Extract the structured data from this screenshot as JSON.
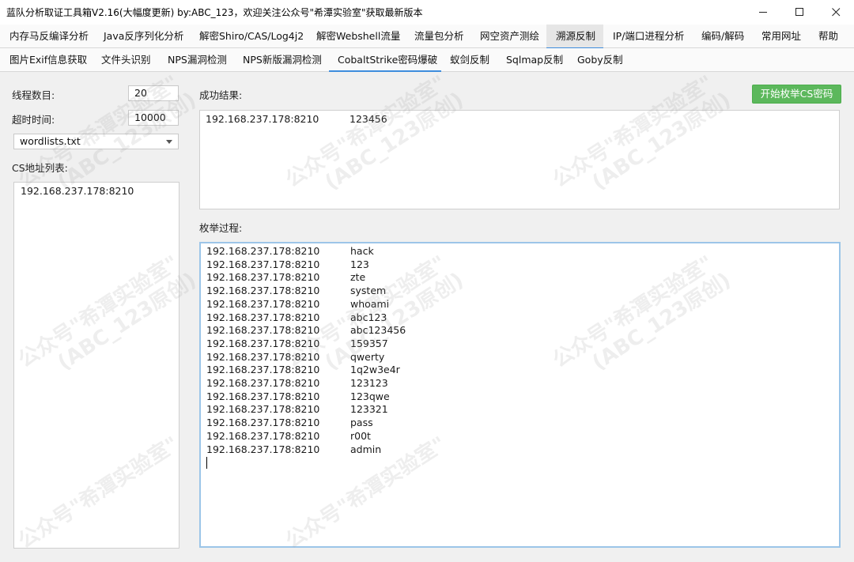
{
  "window": {
    "title": "蓝队分析取证工具箱V2.16(大幅度更新) by:ABC_123，欢迎关注公众号\"希潭实验室\"获取最新版本"
  },
  "menu": {
    "items": [
      "内存马反编译分析",
      "Java反序列化分析",
      "解密Shiro/CAS/Log4j2",
      "解密Webshell流量",
      "流量包分析",
      "网空资产测绘",
      "溯源反制",
      "IP/端口进程分析",
      "编码/解码",
      "常用网址",
      "帮助"
    ],
    "active": "溯源反制"
  },
  "subtabs": {
    "items": [
      "图片Exif信息获取",
      "文件头识别",
      "NPS漏洞检测",
      "NPS新版漏洞检测",
      "CobaltStrike密码爆破",
      "蚁剑反制",
      "Sqlmap反制",
      "Goby反制"
    ],
    "active": "CobaltStrike密码爆破"
  },
  "form": {
    "threads_label": "线程数目:",
    "threads_value": "20",
    "timeout_label": "超时时间:",
    "timeout_value": "10000",
    "wordlist_selected": "wordlists.txt",
    "cs_list_label": "CS地址列表:",
    "cs_list": [
      "192.168.237.178:8210"
    ]
  },
  "results": {
    "label": "成功结果:",
    "rows": [
      [
        "192.168.237.178:8210",
        "123456"
      ]
    ]
  },
  "start_button": "开始枚举CS密码",
  "process": {
    "label": "枚举过程:",
    "rows": [
      [
        "192.168.237.178:8210",
        "hack"
      ],
      [
        "192.168.237.178:8210",
        "123"
      ],
      [
        "192.168.237.178:8210",
        "zte"
      ],
      [
        "192.168.237.178:8210",
        "system"
      ],
      [
        "192.168.237.178:8210",
        "whoami"
      ],
      [
        "192.168.237.178:8210",
        "abc123"
      ],
      [
        "192.168.237.178:8210",
        "abc123456"
      ],
      [
        "192.168.237.178:8210",
        "159357"
      ],
      [
        "192.168.237.178:8210",
        "qwerty"
      ],
      [
        "192.168.237.178:8210",
        "1q2w3e4r"
      ],
      [
        "192.168.237.178:8210",
        "123123"
      ],
      [
        "192.168.237.178:8210",
        "123qwe"
      ],
      [
        "192.168.237.178:8210",
        "123321"
      ],
      [
        "192.168.237.178:8210",
        "pass"
      ],
      [
        "192.168.237.178:8210",
        "r00t"
      ],
      [
        "192.168.237.178:8210",
        "admin"
      ]
    ]
  },
  "watermark": {
    "line1": "公众号\"希潭实验室\"",
    "line2": "(ABC_123原创)"
  },
  "icons": {
    "minimize": "minimize-icon",
    "maximize": "maximize-icon",
    "close": "close-icon",
    "dropdown": "chevron-down-icon"
  }
}
